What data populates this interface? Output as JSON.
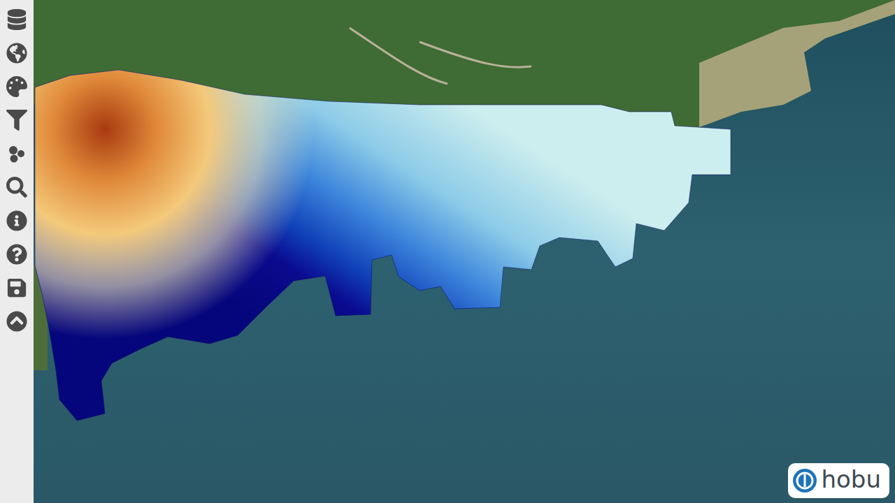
{
  "logo": {
    "text": "hobu"
  }
}
